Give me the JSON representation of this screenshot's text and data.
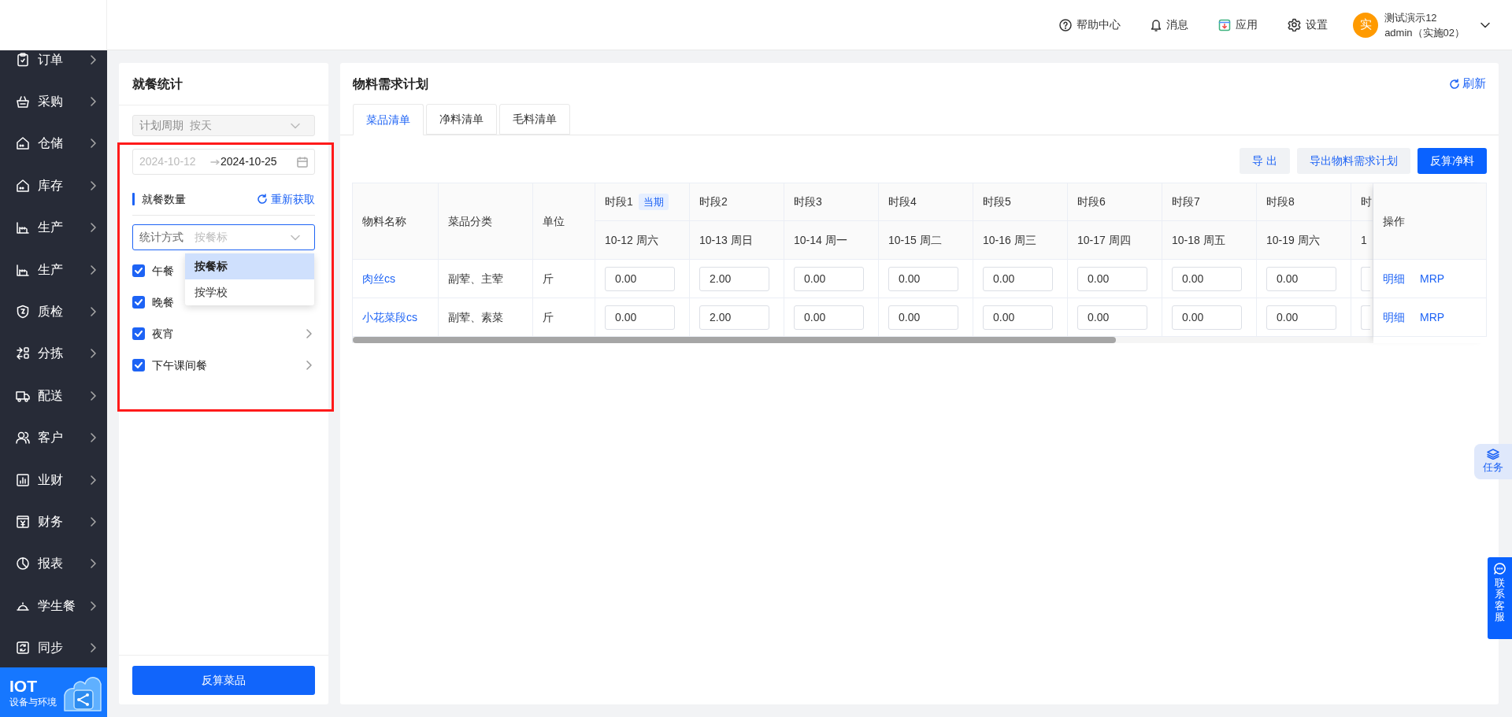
{
  "header": {
    "help": "帮助中心",
    "messages": "消息",
    "apps": "应用",
    "settings": "设置",
    "user": {
      "avatar": "实",
      "name": "测试演示12",
      "account": "admin（实施02）"
    }
  },
  "sidebar": {
    "items": [
      {
        "label": "订单"
      },
      {
        "label": "采购"
      },
      {
        "label": "仓储"
      },
      {
        "label": "库存"
      },
      {
        "label": "生产"
      },
      {
        "label": "生产"
      },
      {
        "label": "质检"
      },
      {
        "label": "分拣"
      },
      {
        "label": "配送"
      },
      {
        "label": "客户"
      },
      {
        "label": "业财"
      },
      {
        "label": "财务"
      },
      {
        "label": "报表"
      },
      {
        "label": "学生餐"
      },
      {
        "label": "同步"
      }
    ],
    "footer": {
      "title": "IOT",
      "subtitle": "设备与环境"
    }
  },
  "left_panel": {
    "title": "就餐统计",
    "plan_period": {
      "label": "计划周期",
      "value": "按天",
      "disabled": true
    },
    "date_range": {
      "start": "2024-10-12",
      "end": "2024-10-25"
    },
    "section": {
      "title": "就餐数量",
      "refresh": "重新获取"
    },
    "stat_method": {
      "label": "统计方式",
      "placeholder": "按餐标",
      "expanded": true,
      "options": [
        {
          "label": "按餐标",
          "selected": true
        },
        {
          "label": "按学校",
          "selected": false
        }
      ]
    },
    "meals": [
      {
        "label": "午餐",
        "checked": true,
        "expandable": false
      },
      {
        "label": "晚餐",
        "checked": true,
        "expandable": false
      },
      {
        "label": "夜宵",
        "checked": true,
        "expandable": true
      },
      {
        "label": "下午课间餐",
        "checked": true,
        "expandable": true
      }
    ],
    "submit": "反算菜品"
  },
  "main_panel": {
    "title": "物料需求计划",
    "refresh": "刷新",
    "tabs": [
      {
        "label": "菜品清单",
        "selected": true
      },
      {
        "label": "净料清单",
        "selected": false
      },
      {
        "label": "毛料清单",
        "selected": false
      }
    ],
    "buttons": [
      {
        "label": "导 出",
        "kind": "secondary"
      },
      {
        "label": "导出物料需求计划",
        "kind": "secondary"
      },
      {
        "label": "反算净料",
        "kind": "primary"
      }
    ],
    "table": {
      "columns": [
        "物料名称",
        "菜品分类",
        "单位"
      ],
      "periods": [
        {
          "label": "时段1",
          "badge": "当期",
          "date": "10-12 周六"
        },
        {
          "label": "时段2",
          "date": "10-13 周日"
        },
        {
          "label": "时段3",
          "date": "10-14 周一"
        },
        {
          "label": "时段4",
          "date": "10-15 周二"
        },
        {
          "label": "时段5",
          "date": "10-16 周三"
        },
        {
          "label": "时段6",
          "date": "10-17 周四"
        },
        {
          "label": "时段7",
          "date": "10-18 周五"
        },
        {
          "label": "时段8",
          "date": "10-19 周六"
        },
        {
          "label": "时",
          "date": "1"
        }
      ],
      "action_column": "操作",
      "rows": [
        {
          "name": "肉丝cs",
          "category": "副荤、主荤",
          "unit": "斤",
          "values": [
            "0.00",
            "2.00",
            "0.00",
            "0.00",
            "0.00",
            "0.00",
            "0.00",
            "0.00"
          ],
          "actions": [
            "明细",
            "MRP"
          ]
        },
        {
          "name": "小花菜段cs",
          "category": "副荤、素菜",
          "unit": "斤",
          "values": [
            "0.00",
            "2.00",
            "0.00",
            "0.00",
            "0.00",
            "0.00",
            "0.00",
            "0.00"
          ],
          "actions": [
            "明细",
            "MRP"
          ]
        }
      ]
    }
  },
  "floating": {
    "task": "任务",
    "service": "联系客服"
  }
}
